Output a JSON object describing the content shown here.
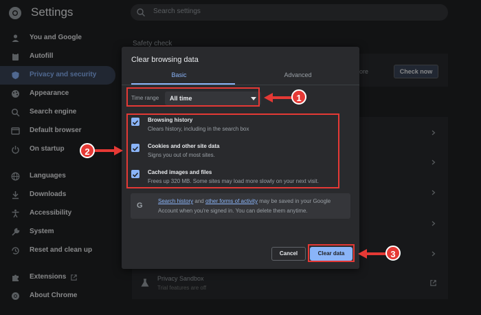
{
  "header": {
    "app_title": "Settings",
    "search_placeholder": "Search settings"
  },
  "sidebar": {
    "items": [
      {
        "label": "You and Google",
        "icon": "person-icon"
      },
      {
        "label": "Autofill",
        "icon": "clipboard-icon"
      },
      {
        "label": "Privacy and security",
        "icon": "shield-icon",
        "active": true
      },
      {
        "label": "Appearance",
        "icon": "palette-icon"
      },
      {
        "label": "Search engine",
        "icon": "search-icon"
      },
      {
        "label": "Default browser",
        "icon": "browser-icon"
      },
      {
        "label": "On startup",
        "icon": "power-icon"
      },
      {
        "label": "Languages",
        "icon": "globe-icon"
      },
      {
        "label": "Downloads",
        "icon": "download-icon"
      },
      {
        "label": "Accessibility",
        "icon": "accessibility-icon"
      },
      {
        "label": "System",
        "icon": "wrench-icon"
      },
      {
        "label": "Reset and clean up",
        "icon": "history-icon"
      },
      {
        "label": "Extensions",
        "icon": "puzzle-icon"
      },
      {
        "label": "About Chrome",
        "icon": "chrome-icon"
      }
    ]
  },
  "main": {
    "safety_check_title": "Safety check",
    "check_now_label": "Check now",
    "partial_text": "ore",
    "privacy_sandbox_title": "Privacy Sandbox",
    "privacy_sandbox_subtitle": "Trial features are off"
  },
  "dialog": {
    "title": "Clear browsing data",
    "tabs": [
      {
        "label": "Basic",
        "active": true
      },
      {
        "label": "Advanced",
        "active": false
      }
    ],
    "time_range_label": "Time range",
    "time_range_value": "All time",
    "options": [
      {
        "title": "Browsing history",
        "subtitle": "Clears history, including in the search box",
        "checked": true
      },
      {
        "title": "Cookies and other site data",
        "subtitle": "Signs you out of most sites.",
        "checked": true
      },
      {
        "title": "Cached images and files",
        "subtitle": "Frees up 320 MB. Some sites may load more slowly on your next visit.",
        "checked": true
      }
    ],
    "info": {
      "link1": "Search history",
      "and_text": " and ",
      "link2": "other forms of activity",
      "rest_line1": " may be saved in your Google",
      "line2": "Account when you're signed in. You can delete them anytime.",
      "g_glyph": "G"
    },
    "cancel_label": "Cancel",
    "clear_label": "Clear data"
  },
  "annotations": {
    "callout_1": "1",
    "callout_2": "2",
    "callout_3": "3",
    "color": "#e53935"
  }
}
